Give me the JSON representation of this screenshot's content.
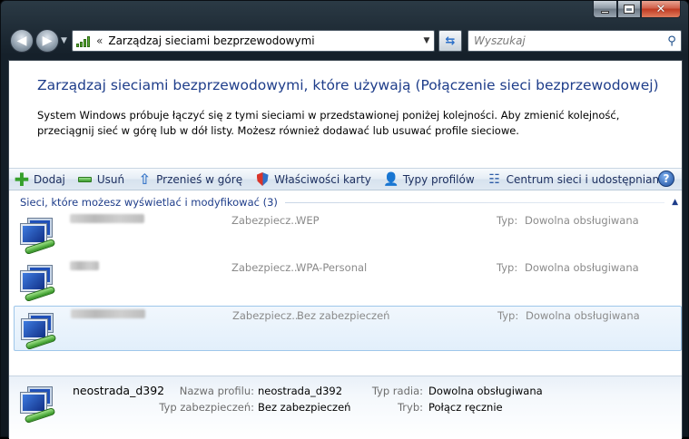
{
  "window": {
    "caption_icons": [
      "minimize-icon",
      "maximize-icon",
      "close-icon"
    ]
  },
  "navbar": {
    "address": "Zarządzaj sieciami bezprzewodowymi",
    "address_prefix": "«",
    "search_placeholder": "Wyszukaj"
  },
  "header": {
    "title": "Zarządzaj sieciami bezprzewodowymi, które używają (Połączenie sieci bezprzewodowej)",
    "description": "System Windows próbuje łączyć się z tymi sieciami w przedstawionej poniżej kolejności. Aby zmienić kolejność, przeciągnij sieć w górę lub w dół listy. Możesz również dodawać lub usuwać profile sieciowe."
  },
  "toolbar": {
    "add": "Dodaj",
    "remove": "Usuń",
    "move_up": "Przenieś w górę",
    "adapter_props": "Właściwości karty",
    "profile_types": "Typy profilów",
    "network_center": "Centrum sieci i udostępniania",
    "help": "?"
  },
  "list": {
    "group_label": "Sieci, które możesz wyświetlać i modyfikować (3)",
    "rows": [
      {
        "security_label": "Zabezpiecz...",
        "security": "WEP",
        "type_label": "Typ:",
        "type": "Dowolna obsługiwana"
      },
      {
        "security_label": "Zabezpiecz...",
        "security": "WPA-Personal",
        "type_label": "Typ:",
        "type": "Dowolna obsługiwana"
      },
      {
        "security_label": "Zabezpiecz...",
        "security": "Bez zabezpieczeń",
        "type_label": "Typ:",
        "type": "Dowolna obsługiwana"
      }
    ]
  },
  "details": {
    "name": "neostrada_d392",
    "profile_label": "Nazwa profilu:",
    "profile": "neostrada_d392",
    "security_label": "Typ zabezpieczeń:",
    "security": "Bez zabezpieczeń",
    "radio_label": "Typ radia:",
    "radio": "Dowolna obsługiwana",
    "mode_label": "Tryb:",
    "mode": "Połącz ręcznie"
  }
}
